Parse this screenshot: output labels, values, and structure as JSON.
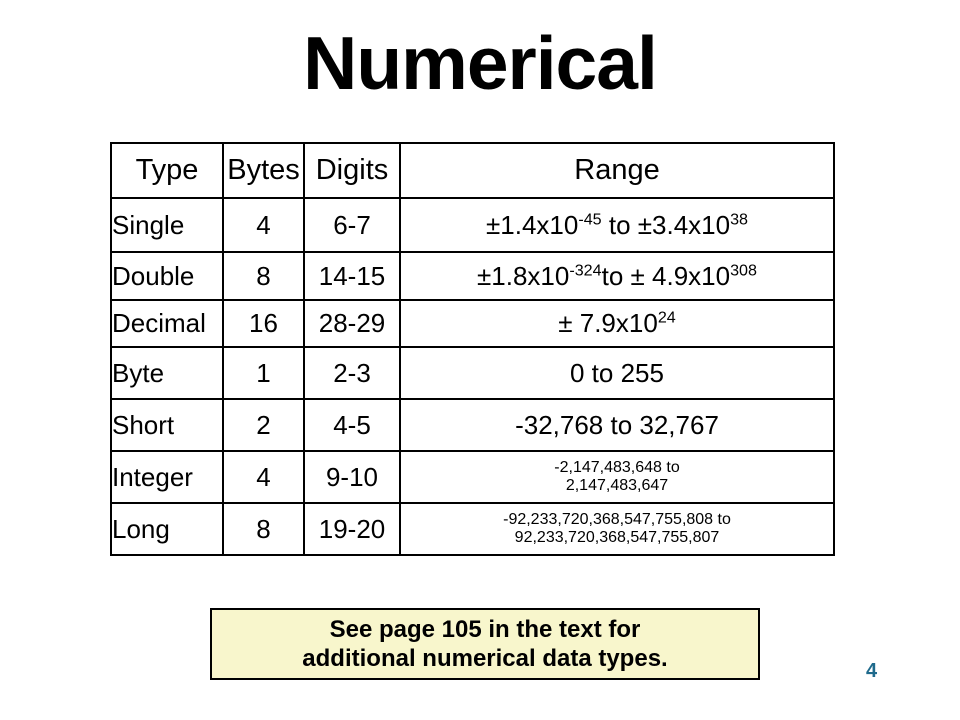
{
  "slide": {
    "title": "Numerical",
    "number": "4",
    "number_color": "#1F6A8C",
    "background_color": "#FFFFFF"
  },
  "table": {
    "headers": {
      "type": "Type",
      "bytes": "Bytes",
      "digits": "Digits",
      "range": "Range"
    },
    "rows": [
      {
        "type": "Single",
        "bytes": "4",
        "digits": "6-7",
        "range_parts": [
          {
            "t": "±1.4x10"
          },
          {
            "sup": "-45"
          },
          {
            "t": " to ±3.4x10"
          },
          {
            "sup": "38"
          }
        ],
        "range_text": "±1.4x10-45 to ±3.4x1038"
      },
      {
        "type": "Double",
        "bytes": "8",
        "digits": "14-15",
        "range_parts": [
          {
            "t": "±1.8x10"
          },
          {
            "sup": "-324"
          },
          {
            "t": "to ± 4.9x10"
          },
          {
            "sup": "308"
          }
        ],
        "range_text": "±1.8x10-324 to ± 4.9x10308"
      },
      {
        "type": "Decimal",
        "bytes": "16",
        "digits": "28-29",
        "range_parts": [
          {
            "t": "± 7.9x10"
          },
          {
            "sup": "24"
          }
        ],
        "range_text": "± 7.9x1024"
      },
      {
        "type": "Byte",
        "bytes": "1",
        "digits": "2-3",
        "range_text": "0 to 255"
      },
      {
        "type": "Short",
        "bytes": "2",
        "digits": "4-5",
        "range_text": "-32,768 to 32,767"
      },
      {
        "type": "Integer",
        "bytes": "4",
        "digits": "9-10",
        "range_line1": "-2,147,483,648 to",
        "range_line2": "2,147,483,647"
      },
      {
        "type": "Long",
        "bytes": "8",
        "digits": "19-20",
        "range_line1": "-92,233,720,368,547,755,808 to",
        "range_line2": "92,233,720,368,547,755,807"
      }
    ]
  },
  "note": {
    "line1": "See page 105 in the text for",
    "line2": "additional numerical data types.",
    "background_color": "#F8F6CC",
    "border_color": "#000000"
  }
}
